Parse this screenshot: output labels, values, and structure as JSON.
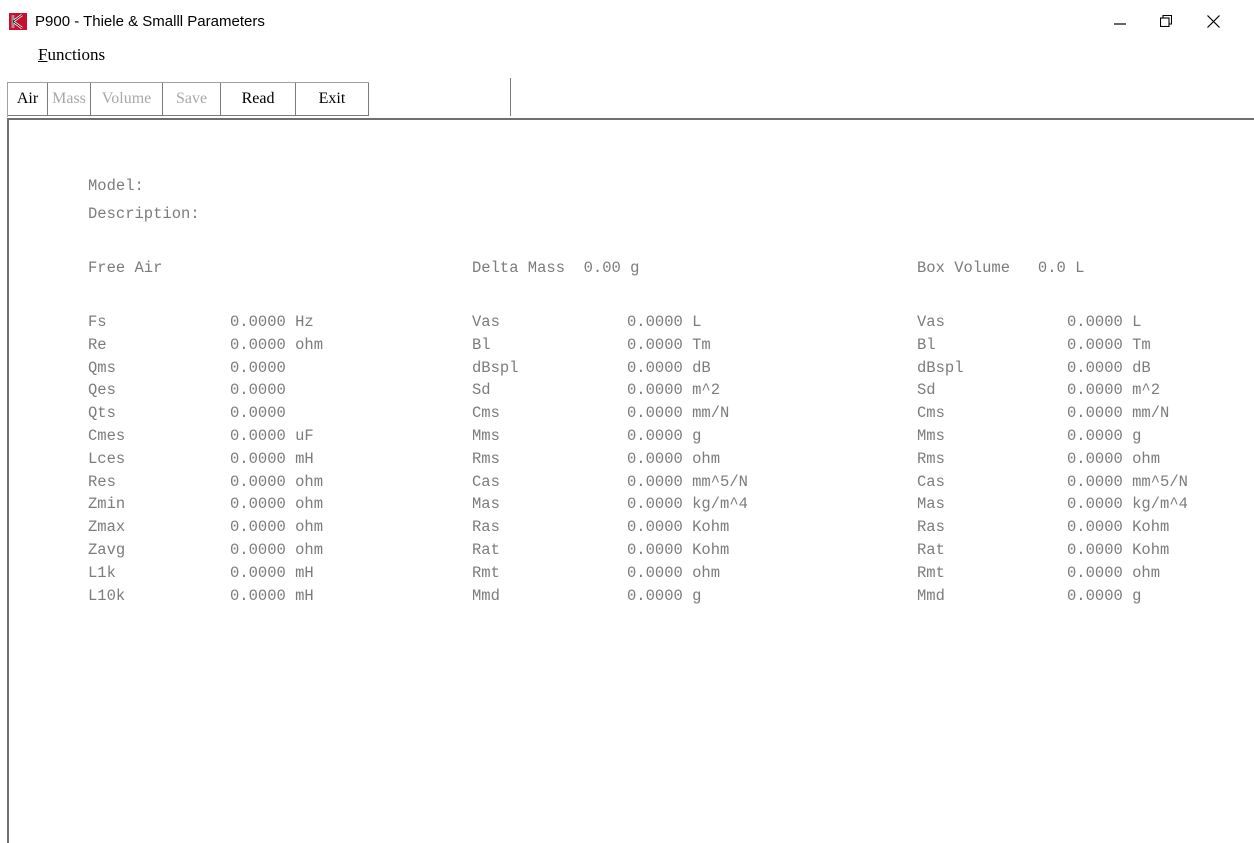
{
  "window": {
    "title": "P900 - Thiele & Smalll Parameters",
    "logo_icon": "app-logo-icon",
    "controls": {
      "minimize_icon": "minimize-icon",
      "maximize_icon": "restore-icon",
      "close_icon": "close-icon"
    }
  },
  "menu": {
    "functions_accel": "F",
    "functions_rest": "unctions"
  },
  "toolbar": {
    "air": "Air",
    "mass": "Mass",
    "volume": "Volume",
    "save": "Save",
    "read": "Read",
    "exit": "Exit"
  },
  "header": {
    "model_label": "Model:",
    "description_label": "Description:",
    "free_air": "Free Air",
    "delta_mass": "Delta Mass  0.00 g",
    "box_volume": "Box Volume   0.0 L"
  },
  "free_air_params": [
    {
      "name": "Fs",
      "value": "0.0000 Hz"
    },
    {
      "name": "Re",
      "value": "0.0000 ohm"
    },
    {
      "name": "Qms",
      "value": "0.0000"
    },
    {
      "name": "Qes",
      "value": "0.0000"
    },
    {
      "name": "Qts",
      "value": "0.0000"
    },
    {
      "name": "Cmes",
      "value": "0.0000 uF"
    },
    {
      "name": "Lces",
      "value": "0.0000 mH"
    },
    {
      "name": "Res",
      "value": "0.0000 ohm"
    },
    {
      "name": "Zmin",
      "value": "0.0000 ohm"
    },
    {
      "name": "Zmax",
      "value": "0.0000 ohm"
    },
    {
      "name": "Zavg",
      "value": "0.0000 ohm"
    },
    {
      "name": "L1k",
      "value": "0.0000 mH"
    },
    {
      "name": "L10k",
      "value": "0.0000 mH"
    }
  ],
  "delta_mass_params": [
    {
      "name": "Vas",
      "value": "0.0000 L"
    },
    {
      "name": "Bl",
      "value": "0.0000 Tm"
    },
    {
      "name": "dBspl",
      "value": "0.0000 dB"
    },
    {
      "name": "Sd",
      "value": "0.0000 m^2"
    },
    {
      "name": "Cms",
      "value": "0.0000 mm/N"
    },
    {
      "name": "Mms",
      "value": "0.0000 g"
    },
    {
      "name": "Rms",
      "value": "0.0000 ohm"
    },
    {
      "name": "Cas",
      "value": "0.0000 mm^5/N"
    },
    {
      "name": "Mas",
      "value": "0.0000 kg/m^4"
    },
    {
      "name": "Ras",
      "value": "0.0000 Kohm"
    },
    {
      "name": "Rat",
      "value": "0.0000 Kohm"
    },
    {
      "name": "Rmt",
      "value": "0.0000 ohm"
    },
    {
      "name": "Mmd",
      "value": "0.0000 g"
    }
  ],
  "box_volume_params": [
    {
      "name": "Vas",
      "value": "0.0000 L"
    },
    {
      "name": "Bl",
      "value": "0.0000 Tm"
    },
    {
      "name": "dBspl",
      "value": "0.0000 dB"
    },
    {
      "name": "Sd",
      "value": "0.0000 m^2"
    },
    {
      "name": "Cms",
      "value": "0.0000 mm/N"
    },
    {
      "name": "Mms",
      "value": "0.0000 g"
    },
    {
      "name": "Rms",
      "value": "0.0000 ohm"
    },
    {
      "name": "Cas",
      "value": "0.0000 mm^5/N"
    },
    {
      "name": "Mas",
      "value": "0.0000 kg/m^4"
    },
    {
      "name": "Ras",
      "value": "0.0000 Kohm"
    },
    {
      "name": "Rat",
      "value": "0.0000 Kohm"
    },
    {
      "name": "Rmt",
      "value": "0.0000 ohm"
    },
    {
      "name": "Mmd",
      "value": "0.0000 g"
    }
  ],
  "colors": {
    "text_gray": "#7c7c7c",
    "disabled_text": "#a8a8a8",
    "logo_red": "#c8102e"
  }
}
